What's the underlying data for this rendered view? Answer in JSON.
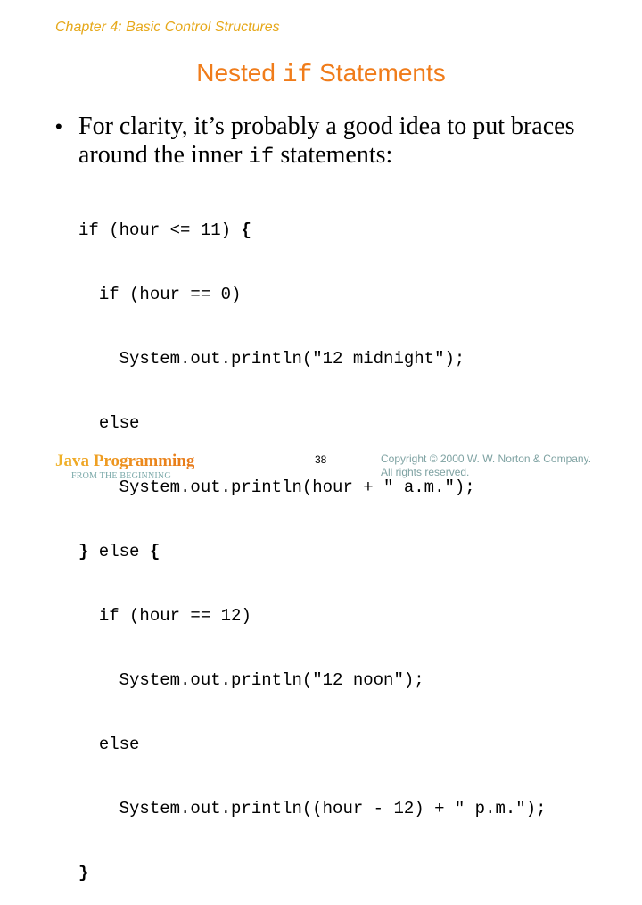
{
  "header": {
    "chapter": "Chapter 4: Basic Control Structures"
  },
  "slide": {
    "title_before": "Nested ",
    "title_code": "if",
    "title_after": " Statements",
    "bullet": {
      "marker": "•",
      "text_line1": "For clarity, it’s probably a good idea to put braces",
      "text_line2_before": "around the inner ",
      "text_line2_code": "if",
      "text_line2_after": " statements:"
    },
    "code_lines": [
      {
        "indent": "",
        "text": "if (hour <= 11) ",
        "brace": "{"
      },
      {
        "indent": "  ",
        "text": "if (hour == 0)",
        "brace": ""
      },
      {
        "indent": "    ",
        "text": "System.out.println(\"12 midnight\");",
        "brace": ""
      },
      {
        "indent": "  ",
        "text": "else",
        "brace": ""
      },
      {
        "indent": "    ",
        "text": "System.out.println(hour + \" a.m.\");",
        "brace": ""
      },
      {
        "indent": "",
        "lead_brace": "}",
        "text": " else ",
        "brace": "{"
      },
      {
        "indent": "  ",
        "text": "if (hour == 12)",
        "brace": ""
      },
      {
        "indent": "    ",
        "text": "System.out.println(\"12 noon\");",
        "brace": ""
      },
      {
        "indent": "  ",
        "text": "else",
        "brace": ""
      },
      {
        "indent": "    ",
        "text": "System.out.println((hour - 12) + \" p.m.\");",
        "brace": ""
      },
      {
        "indent": "",
        "lead_brace": "}",
        "text": "",
        "brace": ""
      }
    ]
  },
  "footer": {
    "brand": "Java Programming",
    "subtitle": "FROM THE BEGINNING",
    "page_number": "38",
    "copyright_line1": "Copyright © 2000 W. W. Norton & Company.",
    "copyright_line2": "All rights reserved."
  },
  "colors": {
    "chapter": "#e6a81a",
    "title": "#f07c1a",
    "brand_gradient_start": "#f0b42a",
    "brand_gradient_end": "#e77a1a",
    "footer_teal": "#7aa8a8"
  }
}
